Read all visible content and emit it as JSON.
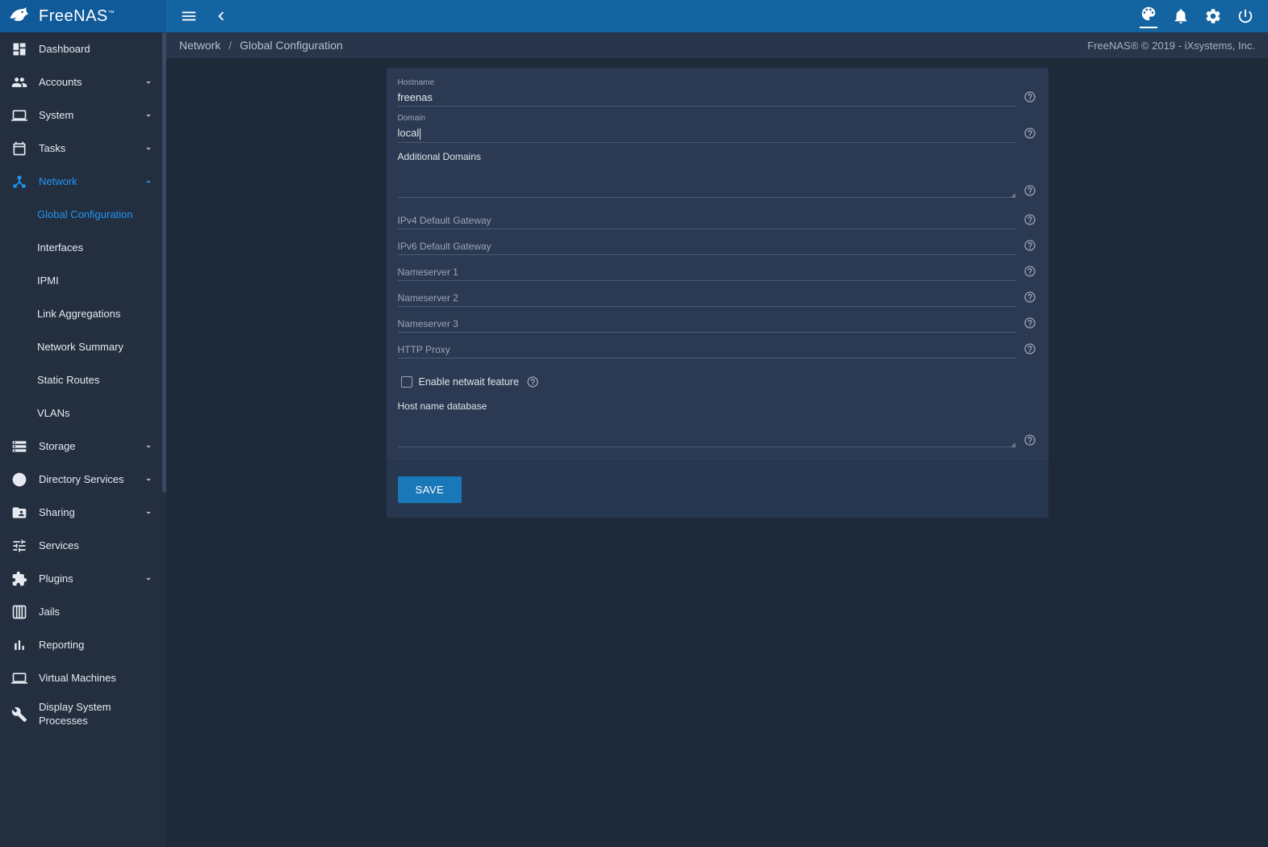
{
  "brand": {
    "name": "FreeNAS",
    "trademark": "™"
  },
  "breadcrumb": {
    "parent": "Network",
    "current": "Global Configuration"
  },
  "footer_text": "FreeNAS® © 2019 - iXsystems, Inc.",
  "sidebar": [
    {
      "key": "dashboard",
      "label": "Dashboard",
      "icon": "dashboard",
      "expandable": false
    },
    {
      "key": "accounts",
      "label": "Accounts",
      "icon": "group",
      "expandable": true
    },
    {
      "key": "system",
      "label": "System",
      "icon": "laptop",
      "expandable": true
    },
    {
      "key": "tasks",
      "label": "Tasks",
      "icon": "calendar",
      "expandable": true
    },
    {
      "key": "network",
      "label": "Network",
      "icon": "device-hub",
      "expandable": true,
      "active": true,
      "expanded": true,
      "children": [
        {
          "key": "global-configuration",
          "label": "Global Configuration",
          "active": true
        },
        {
          "key": "interfaces",
          "label": "Interfaces"
        },
        {
          "key": "ipmi",
          "label": "IPMI"
        },
        {
          "key": "link-aggregations",
          "label": "Link Aggregations"
        },
        {
          "key": "network-summary",
          "label": "Network Summary"
        },
        {
          "key": "static-routes",
          "label": "Static Routes"
        },
        {
          "key": "vlans",
          "label": "VLANs"
        }
      ]
    },
    {
      "key": "storage",
      "label": "Storage",
      "icon": "storage",
      "expandable": true
    },
    {
      "key": "directory-services",
      "label": "Directory Services",
      "icon": "info",
      "expandable": true
    },
    {
      "key": "sharing",
      "label": "Sharing",
      "icon": "folder-shared",
      "expandable": true
    },
    {
      "key": "services",
      "label": "Services",
      "icon": "tune",
      "expandable": false
    },
    {
      "key": "plugins",
      "label": "Plugins",
      "icon": "extension",
      "expandable": true
    },
    {
      "key": "jails",
      "label": "Jails",
      "icon": "jail",
      "expandable": false
    },
    {
      "key": "reporting",
      "label": "Reporting",
      "icon": "bar-chart",
      "expandable": false
    },
    {
      "key": "virtual-machines",
      "label": "Virtual Machines",
      "icon": "laptop",
      "expandable": false
    },
    {
      "key": "display-system-processes",
      "label": "Display System Processes",
      "icon": "build",
      "expandable": false,
      "multiline": true
    }
  ],
  "form": {
    "hostname": {
      "label": "Hostname",
      "value": "freenas"
    },
    "domain": {
      "label": "Domain",
      "value": "local",
      "focused": true
    },
    "additional_domains": {
      "label": "Additional Domains",
      "value": ""
    },
    "ipv4_gateway": {
      "label": "IPv4 Default Gateway",
      "value": ""
    },
    "ipv6_gateway": {
      "label": "IPv6 Default Gateway",
      "value": ""
    },
    "nameserver1": {
      "label": "Nameserver 1",
      "value": ""
    },
    "nameserver2": {
      "label": "Nameserver 2",
      "value": ""
    },
    "nameserver3": {
      "label": "Nameserver 3",
      "value": ""
    },
    "http_proxy": {
      "label": "HTTP Proxy",
      "value": ""
    },
    "netwait": {
      "label": "Enable netwait feature",
      "checked": false
    },
    "host_name_db": {
      "label": "Host name database",
      "value": ""
    },
    "save_label": "SAVE"
  }
}
